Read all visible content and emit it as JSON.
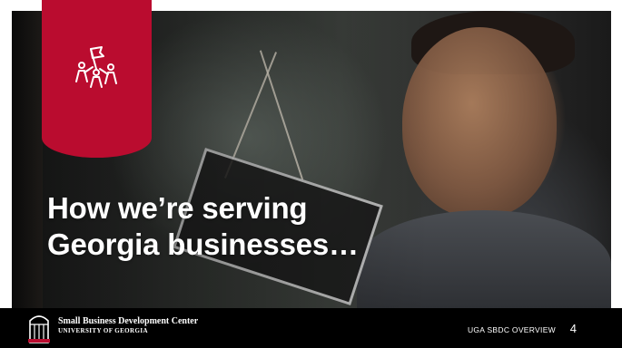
{
  "slide": {
    "headline": {
      "line1": "How we’re serving",
      "line2": "Georgia businesses…"
    },
    "banner": {
      "color": "#ba0c2f",
      "icon": "team-flag-icon"
    },
    "photo": {
      "subject": "photo-background"
    }
  },
  "footer": {
    "logo_icon": "uga-arch-logo-icon",
    "org_name": "Small Business Development Center",
    "university": "UNIVERSITY OF GEORGIA",
    "section_label": "UGA SBDC OVERVIEW",
    "page_number": "4"
  }
}
